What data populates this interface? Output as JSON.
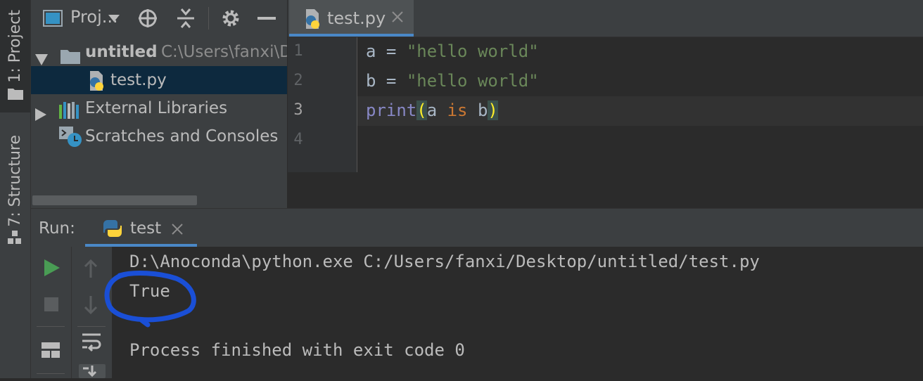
{
  "left_strip": {
    "project_label": "1: Project",
    "structure_label": "7: Structure"
  },
  "project_panel": {
    "title": "Proj...",
    "tree": [
      {
        "label": "untitled",
        "path": "C:\\Users\\fanxi\\D"
      },
      {
        "label": "test.py"
      },
      {
        "label": "External Libraries"
      },
      {
        "label": "Scratches and Consoles"
      }
    ]
  },
  "editor": {
    "tab_label": "test.py",
    "line_numbers": [
      "1",
      "2",
      "3",
      "4"
    ],
    "lines": {
      "l1": {
        "var": "a",
        "op": " = ",
        "str": "\"hello world\""
      },
      "l2": {
        "var": "b",
        "op": " = ",
        "str": "\"hello world\""
      },
      "l3": {
        "fn": "print",
        "lp": "(",
        "a": "a",
        "kw": " is ",
        "b": "b",
        "rp": ")"
      }
    }
  },
  "run": {
    "label": "Run:",
    "tab_label": "test",
    "console": [
      "D:\\Anoconda\\python.exe C:/Users/fanxi/Desktop/untitled/test.py",
      "True",
      "",
      "Process finished with exit code 0"
    ]
  },
  "colors": {
    "accent_circle": "#1a4fd6",
    "keyword": "#cc7832",
    "string": "#6a8759",
    "builtin": "#8888c6",
    "run_green": "#499c54"
  }
}
